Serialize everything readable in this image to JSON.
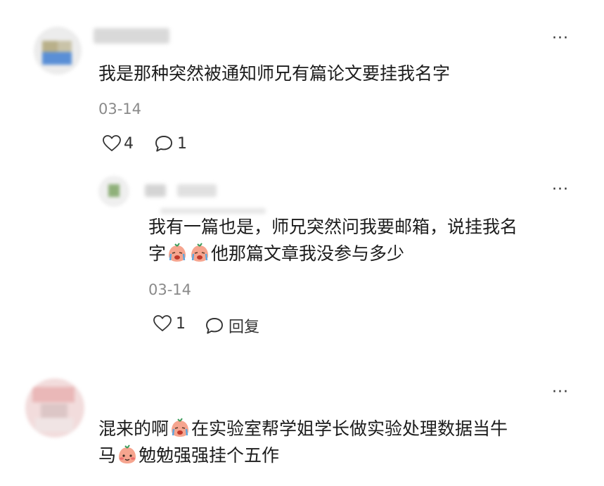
{
  "comments": [
    {
      "text": "我是那种突然被通知师兄有篇论文要挂我名字",
      "date": "03-14",
      "likes": "4",
      "replies": "1",
      "more": "···",
      "reply": {
        "text_a": "我有一篇也是，师兄突然问我要邮箱，说挂我名",
        "text_b1": "字",
        "text_b2": "他那篇文章我没参与多少",
        "date": "03-14",
        "likes": "1",
        "reply_label": "回复",
        "more": "···"
      }
    },
    {
      "text_a1": "混来的啊",
      "text_a2": "在实验室帮学姐学长做实验处理数据当牛",
      "text_b1": "马",
      "text_b2": "勉勉强强挂个五作",
      "more": "···"
    }
  ],
  "icons": {
    "more": "more-dots-icon",
    "like": "heart-outline-icon",
    "comment": "speech-bubble-icon",
    "emoji_cry": "crying-face-emoji",
    "emoji_shy": "shy-face-emoji"
  },
  "colors": {
    "text": "#1c1c1c",
    "meta": "#8a8a8a",
    "icon": "#333333",
    "emoji_face": "#f6a58f"
  }
}
